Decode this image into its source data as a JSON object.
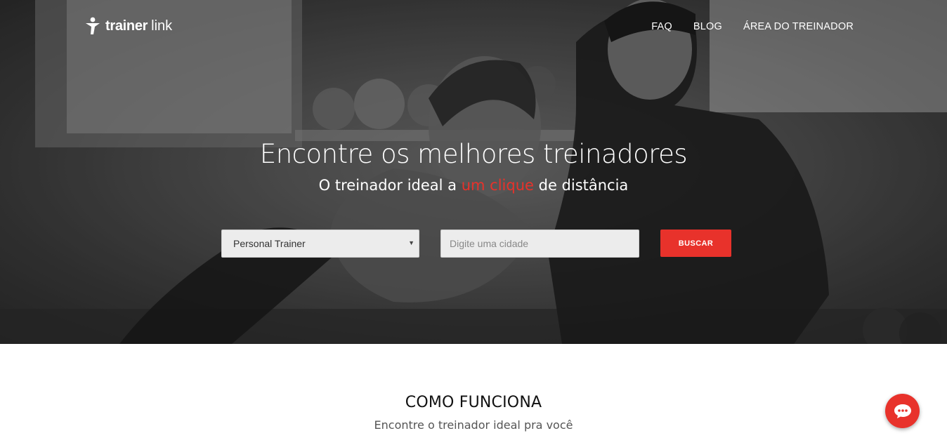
{
  "brand": {
    "name_bold": "trainer",
    "name_light": "link",
    "logo_icon": "runner-icon"
  },
  "nav": {
    "items": [
      {
        "label": "FAQ"
      },
      {
        "label": "BLOG"
      },
      {
        "label": "ÁREA DO TREINADOR"
      }
    ]
  },
  "hero": {
    "headline": "Encontre os melhores treinadores",
    "sub_before": "O treinador ideal a ",
    "sub_highlight": "um clique",
    "sub_after": " de distância",
    "background": "grayscale gym photo of trainer and woman doing push-up"
  },
  "search": {
    "category_selected": "Personal Trainer",
    "city_placeholder": "Digite uma cidade",
    "button_label": "BUSCAR"
  },
  "how_it_works": {
    "title": "COMO FUNCIONA",
    "subtitle": "Encontre o treinador ideal pra você"
  },
  "chat": {
    "icon": "chat-bubble-icon"
  },
  "colors": {
    "accent": "#e8322b",
    "nav_text": "#ffffff",
    "input_bg": "#ececec"
  }
}
